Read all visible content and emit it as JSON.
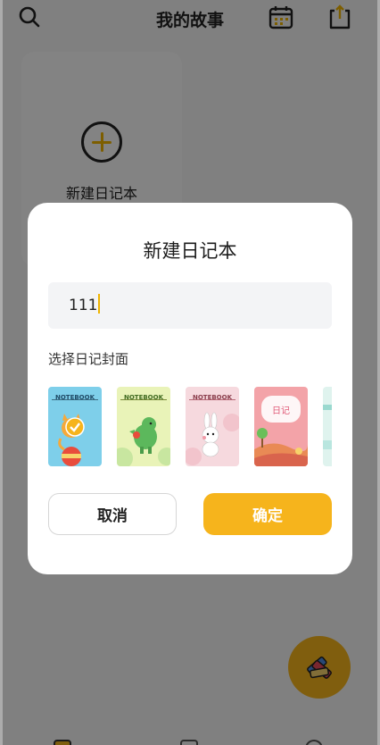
{
  "header": {
    "title": "我的故事",
    "icons": [
      "search-icon",
      "calendar-icon",
      "share-icon"
    ]
  },
  "add_card": {
    "label": "新建日记本"
  },
  "dialog": {
    "title": "新建日记本",
    "name_input": {
      "value": "111"
    },
    "cover_section_label": "选择日记封面",
    "covers": [
      {
        "notebook_text": "NOTEBOOK",
        "theme": "cat-orange",
        "color": "#7ecfea",
        "selected": true
      },
      {
        "notebook_text": "NOTEBOOK",
        "theme": "dinosaur-green",
        "color": "#e9f3b8",
        "selected": false
      },
      {
        "notebook_text": "NOTEBOOK",
        "theme": "bunny-pink",
        "color": "#f6d9de",
        "selected": false
      },
      {
        "notebook_text": "日记",
        "theme": "hills-pink",
        "color": "#f3a3a8",
        "selected": false
      },
      {
        "notebook_text": "",
        "theme": "partial",
        "color": "#dff3ee",
        "selected": false
      }
    ],
    "cancel_label": "取消",
    "confirm_label": "确定"
  },
  "colors": {
    "accent": "#f6b41c",
    "overlay": "rgba(0,0,0,0.48)"
  }
}
